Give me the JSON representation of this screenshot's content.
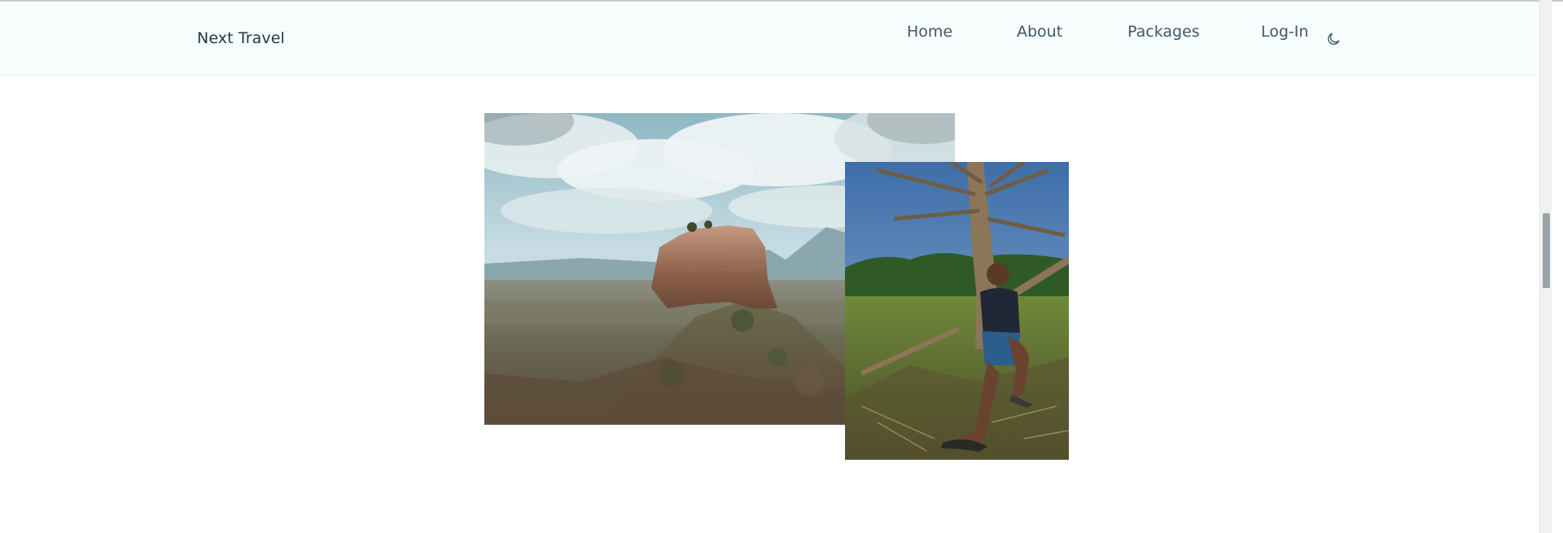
{
  "header": {
    "brand": "Next Travel",
    "nav": [
      {
        "label": "Home"
      },
      {
        "label": "About"
      },
      {
        "label": "Packages"
      },
      {
        "label": "Log-In"
      }
    ],
    "theme_toggle_icon": "moon-icon"
  },
  "gallery": {
    "main_photo": "rock-fortress-photo",
    "secondary_photo": "person-under-tree-photo"
  },
  "colors": {
    "header_bg": "#f7fcfd",
    "nav_text": "#3e5966",
    "brand_text": "#1f3a48"
  }
}
